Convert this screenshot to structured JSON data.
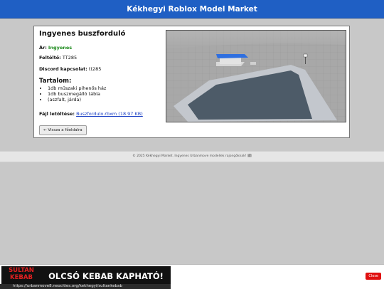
{
  "header": {
    "title": "Kékhegyi Roblox Model Market"
  },
  "item": {
    "title": "Ingyenes buszforduló",
    "price_label": "Ár:",
    "price_value": "Ingyenes",
    "uploader_label": "Feltöltő:",
    "uploader_value": "TT285",
    "discord_label": "Discord kapcsolat:",
    "discord_value": "tt285",
    "contents_heading": "Tartalom:",
    "contents": [
      "1db műszaki pihenős ház",
      "1db buszmegálló tábla",
      "(aszfalt, járda)"
    ],
    "file_label": "Fájl letöltése:",
    "file_link": "Buszfordulo.rbxm (18.97 KB)",
    "back_button": "← Vissza a főoldalra"
  },
  "footer": {
    "text": "© 2025 Kékhegyi Market. Ingyenes Urbanmove modellek rajongóknak! 🗓"
  },
  "ad": {
    "logo_line1": "SULTAN",
    "logo_line2": "KEBAB",
    "banner": "OLCSÓ KEBAB KAPHATÓ!",
    "url": "https://urbanmove8.neocities.org/kekhegyi/sultankebab",
    "close": "Close"
  }
}
